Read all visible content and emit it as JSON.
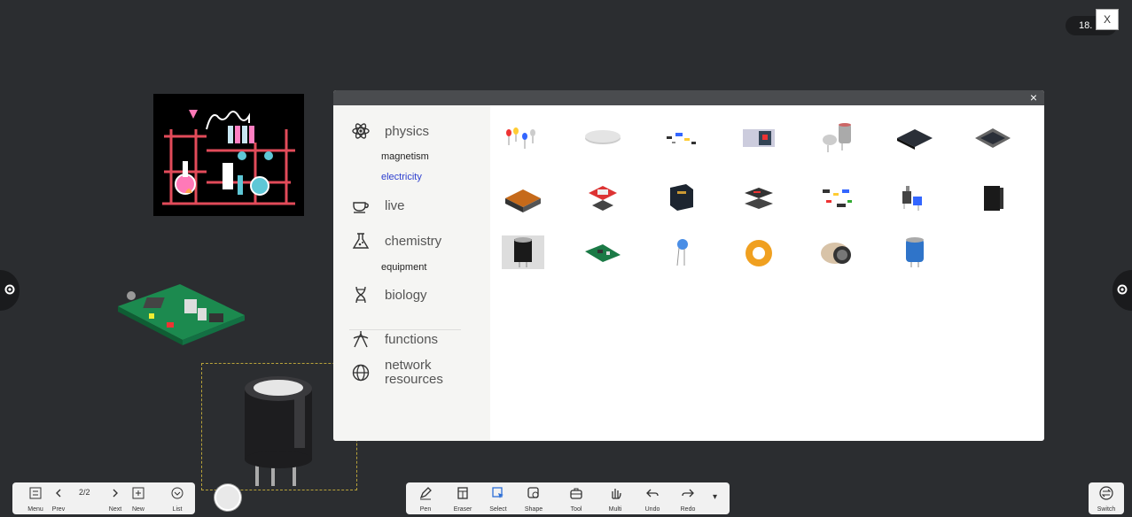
{
  "clock": {
    "text": "18."
  },
  "close_x": "X",
  "panel": {
    "close_label": "×",
    "categories": [
      {
        "label": "physics",
        "icon": "atom-icon"
      },
      {
        "label": "live",
        "icon": "cup-icon"
      },
      {
        "label": "chemistry",
        "icon": "flask-icon"
      },
      {
        "label": "biology",
        "icon": "dna-icon"
      },
      {
        "label": "functions",
        "icon": "compass-icon"
      },
      {
        "label": "network resources",
        "icon": "globe-icon"
      }
    ],
    "subcategories": {
      "magnetism": "magnetism",
      "electricity": "electricity",
      "equipment": "equipment"
    },
    "network_line1": "network",
    "network_line2": "resources",
    "items": [
      "led-diodes",
      "disc-capacitor",
      "small-components",
      "relay-module",
      "cylinder-components",
      "ic-chip",
      "cpu-chip",
      "transformer",
      "sensor-board",
      "film-capacitor",
      "ic-packages",
      "component-kit",
      "potentiometers",
      "black-module",
      "electrolytic-capacitor",
      "green-circuit-board",
      "ceramic-capacitor",
      "toroid-coil",
      "inductor-coil",
      "blue-capacitor"
    ]
  },
  "toolbar_left": {
    "menu": "Menu",
    "prev": "Prev",
    "page": "2/2",
    "next": "Next",
    "new": "New",
    "list": "List"
  },
  "toolbar_mid": {
    "pen": "Pen",
    "eraser": "Eraser",
    "select": "Select",
    "shape": "Shape",
    "tool": "Tool",
    "multi": "Multi",
    "undo": "Undo",
    "redo": "Redo"
  },
  "switch": "Switch",
  "colors": {
    "background": "#2b2d30",
    "accent_blue": "#2d3fcf",
    "panel_header": "#4a4c4f"
  }
}
